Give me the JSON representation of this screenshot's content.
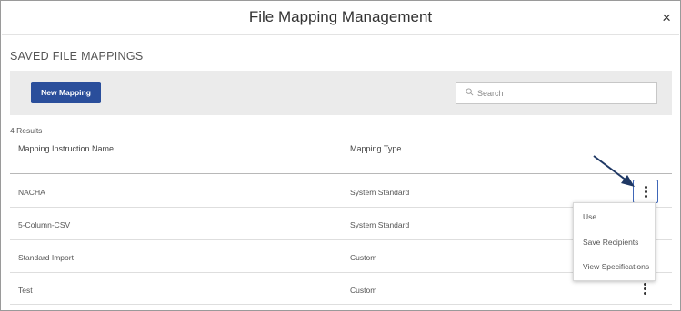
{
  "dialog": {
    "title": "File Mapping Management",
    "close_glyph": "×"
  },
  "section_title": "SAVED FILE MAPPINGS",
  "toolbar": {
    "new_button_label": "New Mapping",
    "search_placeholder": "Search"
  },
  "results_count": "4 Results",
  "table": {
    "columns": [
      "Mapping Instruction Name",
      "Mapping Type"
    ],
    "rows": [
      {
        "name": "NACHA",
        "type": "System Standard"
      },
      {
        "name": "5-Column-CSV",
        "type": "System Standard"
      },
      {
        "name": "Standard Import",
        "type": "Custom"
      },
      {
        "name": "Test",
        "type": "Custom"
      }
    ]
  },
  "action_menu": {
    "items": [
      "Use",
      "Save Recipients",
      "View Specifications"
    ]
  },
  "colors": {
    "primary_button": "#2a4e9b",
    "toolbar_bg": "#ebebeb",
    "annotation_arrow": "#1f3864",
    "active_outline": "#3f67b8"
  },
  "icons": {
    "close": "close-icon",
    "search": "search-icon",
    "row_actions": "kebab-icon",
    "annotation": "arrow-icon"
  }
}
